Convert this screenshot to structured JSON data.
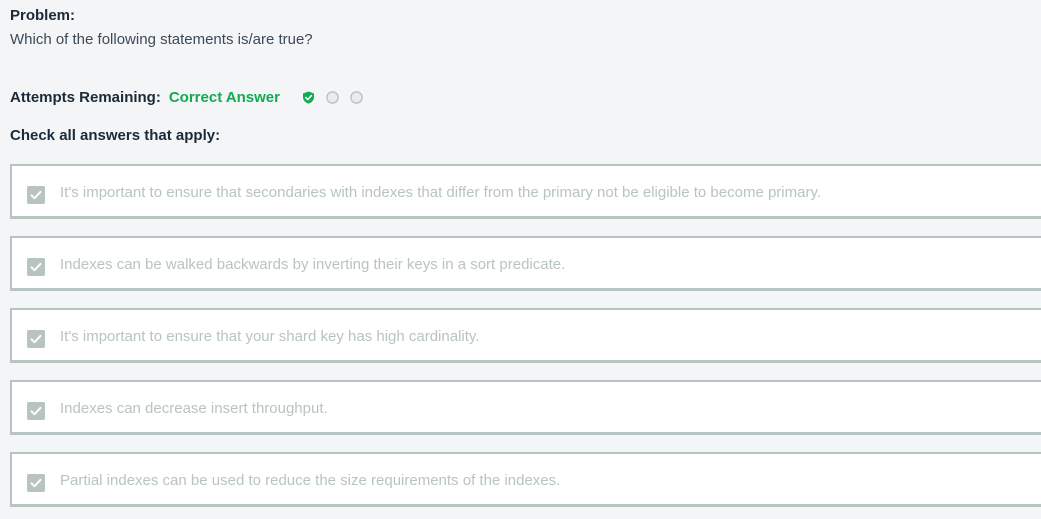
{
  "problem": {
    "label": "Problem:",
    "question": "Which of the following statements is/are true?"
  },
  "attempts": {
    "label": "Attempts Remaining:",
    "status": "Correct Answer",
    "status_color": "#13aa52",
    "indicators": [
      {
        "icon": "shield-check-icon",
        "state": "used-correct"
      },
      {
        "icon": "empty-circle-icon",
        "state": "unused"
      },
      {
        "icon": "empty-circle-icon",
        "state": "unused"
      }
    ]
  },
  "instructions": "Check all answers that apply:",
  "options": [
    {
      "text": "It's important to ensure that secondaries with indexes that differ from the primary not be eligible to become primary.",
      "checked": true
    },
    {
      "text": "Indexes can be walked backwards by inverting their keys in a sort predicate.",
      "checked": true
    },
    {
      "text": "It's important to ensure that your shard key has high cardinality.",
      "checked": true
    },
    {
      "text": "Indexes can decrease insert throughput.",
      "checked": true
    },
    {
      "text": "Partial indexes can be used to reduce the size requirements of the indexes.",
      "checked": true
    }
  ]
}
